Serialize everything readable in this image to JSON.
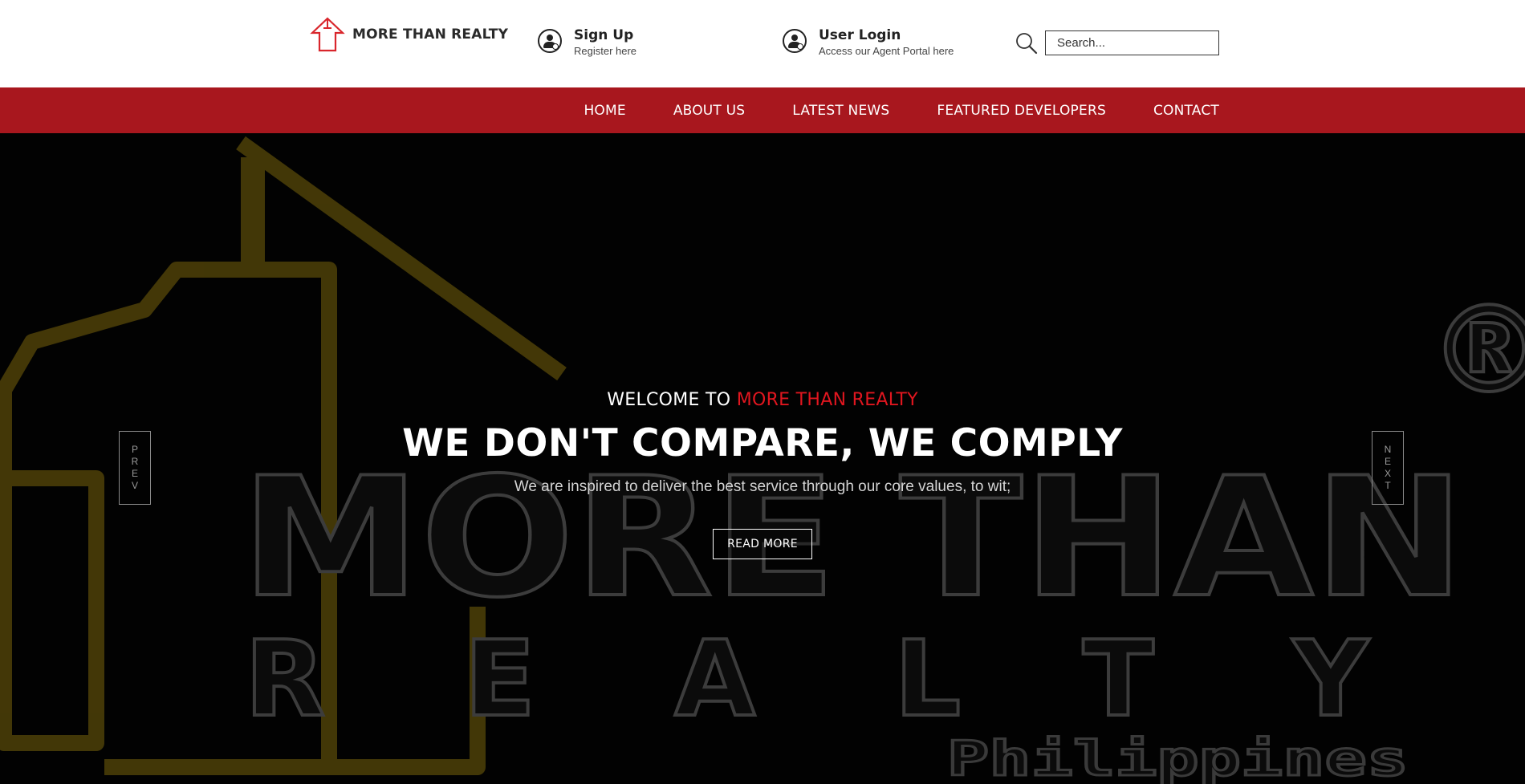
{
  "header": {
    "logo_text": "MORE THAN REALTY",
    "signup": {
      "title": "Sign Up",
      "subtitle": "Register here"
    },
    "login": {
      "title": "User Login",
      "subtitle": "Access our Agent Portal here"
    },
    "search": {
      "placeholder": "Search..."
    }
  },
  "nav": {
    "items": [
      {
        "label": "HOME"
      },
      {
        "label": "ABOUT US"
      },
      {
        "label": "LATEST NEWS"
      },
      {
        "label": "FEATURED DEVELOPERS"
      },
      {
        "label": "CONTACT"
      }
    ]
  },
  "hero": {
    "welcome_prefix": "WELCOME TO ",
    "welcome_brand": "MORE THAN REALTY",
    "headline": "WE DON'T COMPARE, WE COMPLY",
    "tagline": "We are inspired to deliver the best service through our core values, to wit;",
    "cta_label": "READ MORE",
    "prev_letters": [
      "P",
      "R",
      "E",
      "V"
    ],
    "next_letters": [
      "N",
      "E",
      "X",
      "T"
    ],
    "background_logo": {
      "line1": "MORE THAN",
      "line2": "REALTY",
      "line3": "Philippines",
      "registered_mark": "®"
    }
  },
  "colors": {
    "accent_red": "#a8171e",
    "brand_red": "#e0161f",
    "hero_bg": "#020202",
    "house_outline": "#4a3d08"
  },
  "icons": {
    "logo": "house-arrow-icon",
    "signup": "user-add-icon",
    "login": "user-login-icon",
    "search": "magnifier-icon"
  }
}
